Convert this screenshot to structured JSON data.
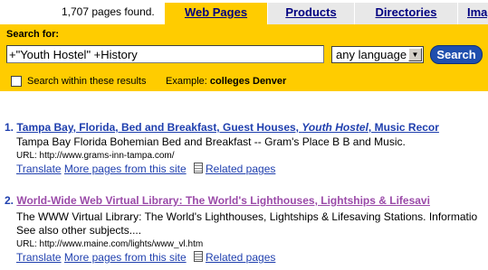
{
  "header": {
    "count_text": "1,707 pages found.",
    "tabs": [
      {
        "label": "Web Pages"
      },
      {
        "label": "Products"
      },
      {
        "label": "Directories"
      },
      {
        "label": "Imag"
      }
    ]
  },
  "search": {
    "label": "Search for:",
    "query": "+\"Youth Hostel\" +History",
    "language": "any language",
    "button": "Search",
    "within_label": "Search within these results",
    "example_prefix": "Example: ",
    "example_text": "colleges Denver"
  },
  "results": [
    {
      "number": "1.",
      "title_pre": "Tampa Bay, Florida, Bed and Breakfast, Guest Houses, ",
      "title_em": "Youth Hostel",
      "title_post": ", Music Recor",
      "description": "Tampa Bay Florida Bohemian Bed and Breakfast -- Gram's Place B B and Music.",
      "url": "URL: http://www.grams-inn-tampa.com/",
      "translate": "Translate",
      "more": "More pages from this site",
      "related": "Related pages"
    },
    {
      "number": "2.",
      "title": "World-Wide Web Virtual Library: The World's Lighthouses, Lightships & Lifesavi",
      "description": "The WWW Virtual Library: The World's Lighthouses, Lightships & Lifesaving Stations. Informatio",
      "description2": "See also other subjects....",
      "url": "URL: http://www.maine.com/lights/www_vl.htm",
      "translate": "Translate",
      "more": "More pages from this site",
      "related": "Related pages"
    }
  ]
}
